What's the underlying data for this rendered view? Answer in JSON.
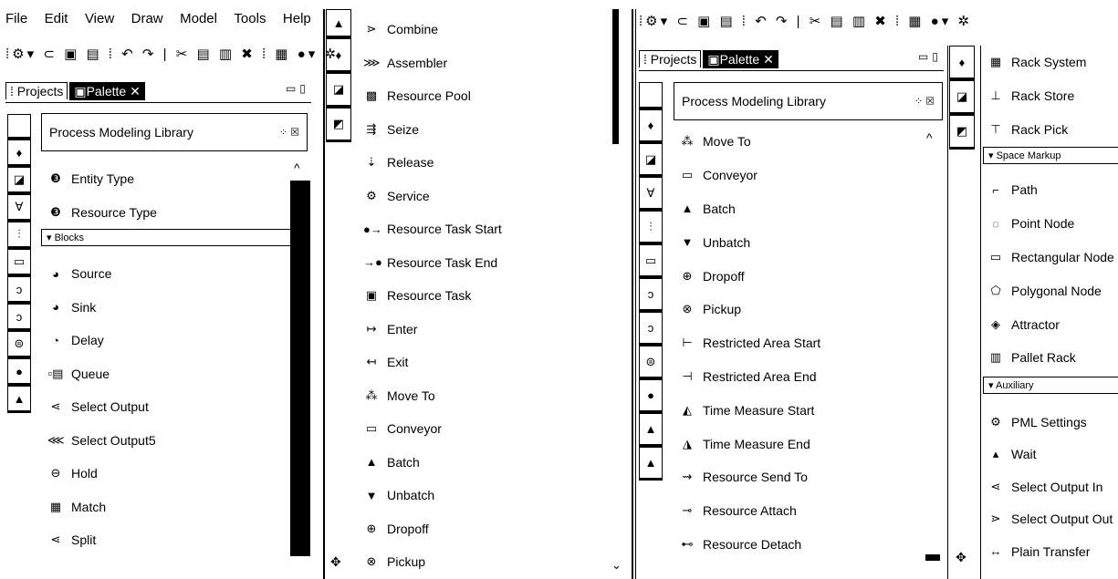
{
  "left_window": {
    "menu": [
      "File",
      "Edit",
      "View",
      "Draw",
      "Model",
      "Tools",
      "Help"
    ],
    "tabs": {
      "projects": "Projects",
      "palette": "Palette"
    },
    "library_title": "Process Modeling Library",
    "top_items": [
      {
        "label": "Entity Type",
        "icon": "entity-type-icon",
        "glyph": "❸"
      },
      {
        "label": "Resource Type",
        "icon": "resource-type-icon",
        "glyph": "❸"
      }
    ],
    "blocks_header": "Blocks",
    "block_items": [
      {
        "label": "Source",
        "icon": "source-icon",
        "glyph": "◕"
      },
      {
        "label": "Sink",
        "icon": "sink-icon",
        "glyph": "◕"
      },
      {
        "label": "Delay",
        "icon": "delay-icon",
        "glyph": "◔"
      },
      {
        "label": "Queue",
        "icon": "queue-icon",
        "glyph": "▫▤"
      },
      {
        "label": "Select Output",
        "icon": "select-output-icon",
        "glyph": "⋖"
      },
      {
        "label": "Select Output5",
        "icon": "select-output5-icon",
        "glyph": "⋘"
      },
      {
        "label": "Hold",
        "icon": "hold-icon",
        "glyph": "⊖"
      },
      {
        "label": "Match",
        "icon": "match-icon",
        "glyph": "▦"
      },
      {
        "label": "Split",
        "icon": "split-icon",
        "glyph": "⋖"
      }
    ],
    "palette_items": [
      {
        "label": "Combine",
        "icon": "combine-icon",
        "glyph": "⋗"
      },
      {
        "label": "Assembler",
        "icon": "assembler-icon",
        "glyph": "⋙"
      },
      {
        "label": "Resource Pool",
        "icon": "resource-pool-icon",
        "glyph": "▩"
      },
      {
        "label": "Seize",
        "icon": "seize-icon",
        "glyph": "⇶"
      },
      {
        "label": "Release",
        "icon": "release-icon",
        "glyph": "⇣"
      },
      {
        "label": "Service",
        "icon": "service-icon",
        "glyph": "⚙"
      },
      {
        "label": "Resource Task Start",
        "icon": "resource-task-start-icon",
        "glyph": "●→"
      },
      {
        "label": "Resource Task End",
        "icon": "resource-task-end-icon",
        "glyph": "→●"
      },
      {
        "label": "Resource Task",
        "icon": "resource-task-icon",
        "glyph": "▣"
      },
      {
        "label": "Enter",
        "icon": "enter-icon",
        "glyph": "↦"
      },
      {
        "label": "Exit",
        "icon": "exit-icon",
        "glyph": "↤"
      },
      {
        "label": "Move To",
        "icon": "move-to-icon",
        "glyph": "⁂"
      },
      {
        "label": "Conveyor",
        "icon": "conveyor-icon",
        "glyph": "▭"
      },
      {
        "label": "Batch",
        "icon": "batch-icon",
        "glyph": "▲"
      },
      {
        "label": "Unbatch",
        "icon": "unbatch-icon",
        "glyph": "▼"
      },
      {
        "label": "Dropoff",
        "icon": "dropoff-icon",
        "glyph": "⊕"
      },
      {
        "label": "Pickup",
        "icon": "pickup-icon",
        "glyph": "⊗"
      }
    ]
  },
  "right_window": {
    "tabs": {
      "projects": "Projects",
      "palette": "Palette"
    },
    "library_title": "Process Modeling Library",
    "items": [
      {
        "label": "Move To",
        "icon": "move-to-icon",
        "glyph": "⁂"
      },
      {
        "label": "Conveyor",
        "icon": "conveyor-icon",
        "glyph": "▭"
      },
      {
        "label": "Batch",
        "icon": "batch-icon",
        "glyph": "▲"
      },
      {
        "label": "Unbatch",
        "icon": "unbatch-icon",
        "glyph": "▼"
      },
      {
        "label": "Dropoff",
        "icon": "dropoff-icon",
        "glyph": "⊕"
      },
      {
        "label": "Pickup",
        "icon": "pickup-icon",
        "glyph": "⊗"
      },
      {
        "label": "Restricted Area Start",
        "icon": "restricted-area-start-icon",
        "glyph": "⊢"
      },
      {
        "label": "Restricted Area End",
        "icon": "restricted-area-end-icon",
        "glyph": "⊣"
      },
      {
        "label": "Time Measure Start",
        "icon": "time-measure-start-icon",
        "glyph": "◭"
      },
      {
        "label": "Time Measure End",
        "icon": "time-measure-end-icon",
        "glyph": "◮"
      },
      {
        "label": "Resource Send To",
        "icon": "resource-send-to-icon",
        "glyph": "⇝"
      },
      {
        "label": "Resource Attach",
        "icon": "resource-attach-icon",
        "glyph": "⊸"
      },
      {
        "label": "Resource Detach",
        "icon": "resource-detach-icon",
        "glyph": "⊷"
      }
    ],
    "rack_items": [
      {
        "label": "Rack System",
        "icon": "rack-system-icon",
        "glyph": "▦"
      },
      {
        "label": "Rack Store",
        "icon": "rack-store-icon",
        "glyph": "⊥"
      },
      {
        "label": "Rack Pick",
        "icon": "rack-pick-icon",
        "glyph": "⊤"
      }
    ],
    "space_markup_header": "Space Markup",
    "space_markup_items": [
      {
        "label": "Path",
        "icon": "path-icon",
        "glyph": "⌐"
      },
      {
        "label": "Point Node",
        "icon": "point-node-icon",
        "glyph": "◌"
      },
      {
        "label": "Rectangular Node",
        "icon": "rectangular-node-icon",
        "glyph": "▭"
      },
      {
        "label": "Polygonal Node",
        "icon": "polygonal-node-icon",
        "glyph": "⬠"
      },
      {
        "label": "Attractor",
        "icon": "attractor-icon",
        "glyph": "◈"
      },
      {
        "label": "Pallet Rack",
        "icon": "pallet-rack-icon",
        "glyph": "▥"
      }
    ],
    "auxiliary_header": "Auxiliary",
    "auxiliary_items": [
      {
        "label": "PML Settings",
        "icon": "pml-settings-icon",
        "glyph": "⚙"
      },
      {
        "label": "Wait",
        "icon": "wait-icon",
        "glyph": "▴"
      },
      {
        "label": "Select Output In",
        "icon": "select-output-in-icon",
        "glyph": "⋖"
      },
      {
        "label": "Select Output Out",
        "icon": "select-output-out-icon",
        "glyph": "⋗"
      },
      {
        "label": "Plain Transfer",
        "icon": "plain-transfer-icon",
        "glyph": "↔"
      }
    ]
  }
}
